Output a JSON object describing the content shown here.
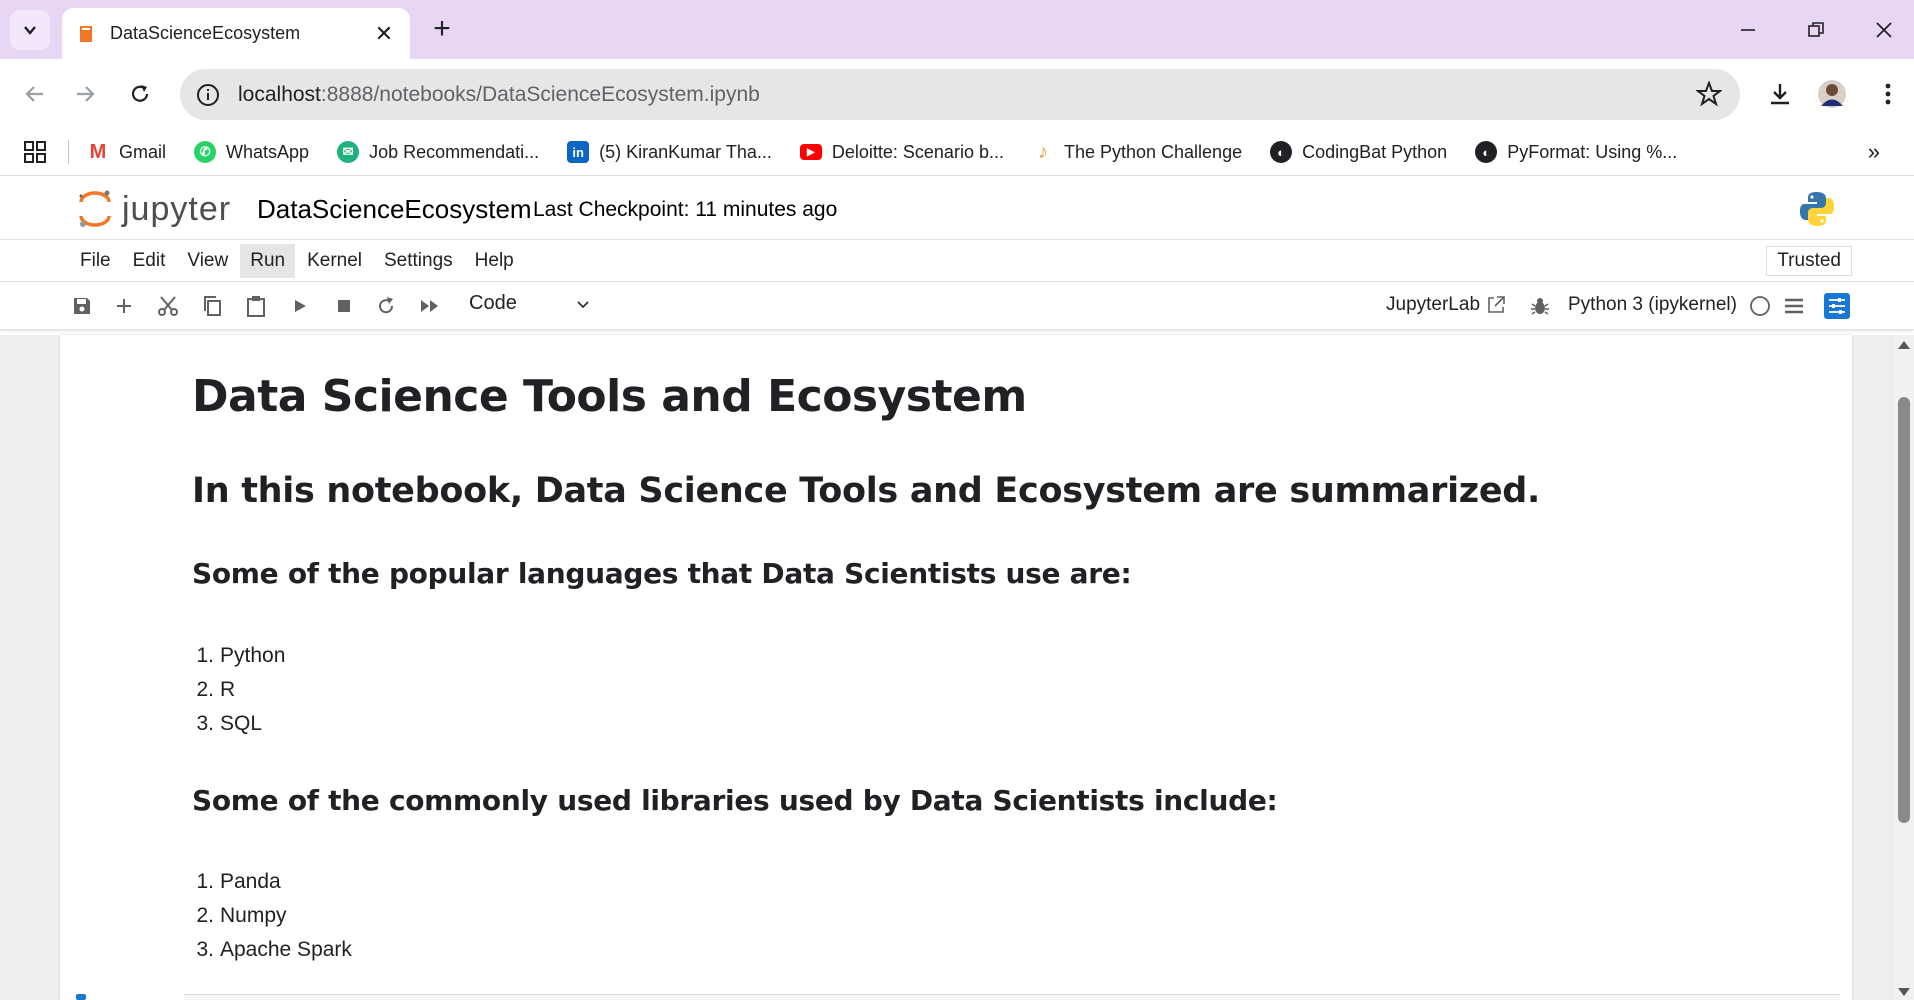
{
  "browser": {
    "tab_title": "DataScienceEcosystem",
    "url_host": "localhost",
    "url_path": ":8888/notebooks/DataScienceEcosystem.ipynb",
    "bookmarks": [
      {
        "label": "Gmail",
        "icon": "gmail-icon",
        "color": "#ea4335"
      },
      {
        "label": "WhatsApp",
        "icon": "whatsapp-icon",
        "color": "#25d366"
      },
      {
        "label": "Job Recommendati...",
        "icon": "job-icon",
        "color": "#20b27a"
      },
      {
        "label": "(5) KiranKumar Tha...",
        "icon": "linkedin-icon",
        "color": "#0a66c2"
      },
      {
        "label": "Deloitte: Scenario b...",
        "icon": "youtube-icon",
        "color": "#ff0000"
      },
      {
        "label": "The Python Challenge",
        "icon": "python-challenge-icon",
        "color": "#e8a33d"
      },
      {
        "label": "CodingBat Python",
        "icon": "globe-icon",
        "color": "#202124"
      },
      {
        "label": "PyFormat: Using %...",
        "icon": "globe-icon",
        "color": "#202124"
      }
    ]
  },
  "jupyter": {
    "logo_text": "jupyter",
    "notebook_name": "DataScienceEcosystem",
    "checkpoint": "Last Checkpoint: 11 minutes ago",
    "menu": [
      "File",
      "Edit",
      "View",
      "Run",
      "Kernel",
      "Settings",
      "Help"
    ],
    "active_menu": "Run",
    "trusted": "Trusted",
    "cell_type": "Code",
    "jupyterlab_link": "JupyterLab",
    "kernel": "Python 3 (ipykernel)"
  },
  "notebook": {
    "title": "Data Science Tools and Ecosystem",
    "intro": "In this notebook, Data Science Tools and Ecosystem are summarized.",
    "languages_heading": "Some of the popular languages that Data Scientists use are:",
    "languages": [
      "Python",
      "R",
      "SQL"
    ],
    "libraries_heading": "Some of the commonly used libraries used by Data Scientists include:",
    "libraries": [
      "Panda",
      "Numpy",
      "Apache Spark"
    ]
  },
  "colors": {
    "tabstrip": "#e8d6f5",
    "jupyter_orange": "#f37726",
    "accent_blue": "#1976d2"
  }
}
